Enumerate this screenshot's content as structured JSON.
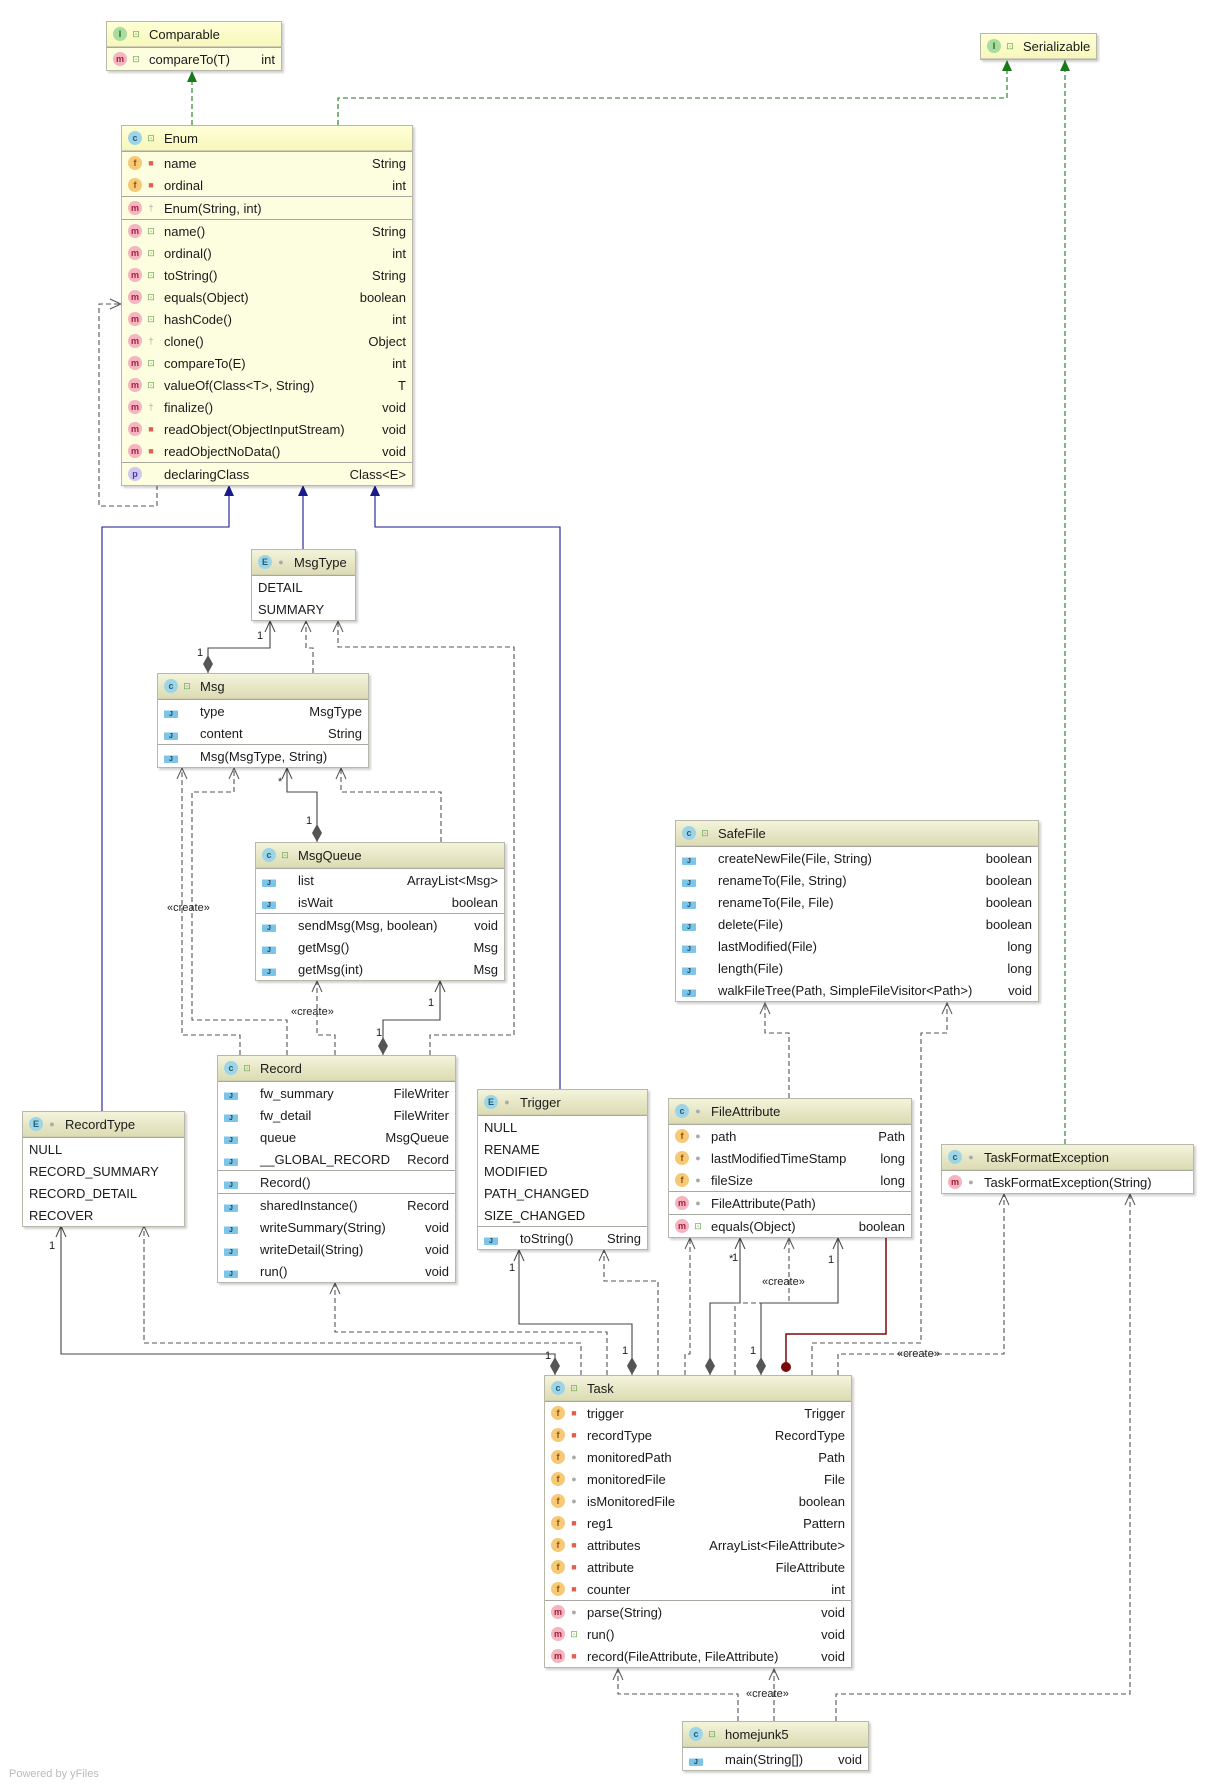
{
  "colors": {
    "realization": "#1a7a1a",
    "inheritance": "#1a1a8a",
    "dependency": "#555555",
    "composition": "#444444",
    "inner": "#7a0a0a"
  },
  "classes": [
    {
      "id": "comparable",
      "name": "Comparable",
      "kind": "i",
      "vis": "pub",
      "lib": true,
      "sections": [
        [
          {
            "icon": "m",
            "vis": "pub",
            "label": "compareTo(T)",
            "type": "int"
          }
        ]
      ]
    },
    {
      "id": "serializable",
      "name": "Serializable",
      "kind": "i",
      "vis": "pub",
      "lib": true,
      "sections": []
    },
    {
      "id": "enum",
      "name": "Enum",
      "kind": "c",
      "vis": "pub",
      "lib": true,
      "sections": [
        [
          {
            "icon": "f",
            "vis": "priv",
            "label": "name",
            "type": "String"
          },
          {
            "icon": "f",
            "vis": "priv",
            "label": "ordinal",
            "type": "int"
          }
        ],
        [
          {
            "icon": "m",
            "vis": "prot",
            "label": "Enum(String, int)",
            "type": ""
          }
        ],
        [
          {
            "icon": "m",
            "vis": "pub",
            "label": "name()",
            "type": "String"
          },
          {
            "icon": "m",
            "vis": "pub",
            "label": "ordinal()",
            "type": "int"
          },
          {
            "icon": "m",
            "vis": "pub",
            "label": "toString()",
            "type": "String"
          },
          {
            "icon": "m",
            "vis": "pub",
            "label": "equals(Object)",
            "type": "boolean"
          },
          {
            "icon": "m",
            "vis": "pub",
            "label": "hashCode()",
            "type": "int"
          },
          {
            "icon": "m",
            "vis": "prot",
            "label": "clone()",
            "type": "Object"
          },
          {
            "icon": "m",
            "vis": "pub",
            "label": "compareTo(E)",
            "type": "int"
          },
          {
            "icon": "m",
            "vis": "pub",
            "label": "valueOf(Class<T>, String)",
            "type": "T"
          },
          {
            "icon": "m",
            "vis": "prot",
            "label": "finalize()",
            "type": "void"
          },
          {
            "icon": "m",
            "vis": "priv",
            "label": "readObject(ObjectInputStream)",
            "type": "void"
          },
          {
            "icon": "m",
            "vis": "priv",
            "label": "readObjectNoData()",
            "type": "void"
          }
        ],
        [
          {
            "icon": "p",
            "vis": "none",
            "label": "declaringClass",
            "type": "Class<E>"
          }
        ]
      ]
    },
    {
      "id": "msgtype",
      "name": "MsgType",
      "kind": "e",
      "vis": "pkg",
      "lib": false,
      "sections": [
        [
          {
            "icon": "",
            "vis": "",
            "label": "DETAIL",
            "type": ""
          },
          {
            "icon": "",
            "vis": "",
            "label": "SUMMARY",
            "type": ""
          }
        ]
      ]
    },
    {
      "id": "msg",
      "name": "Msg",
      "kind": "c",
      "vis": "pub",
      "lib": false,
      "sections": [
        [
          {
            "icon": "s",
            "vis": "none",
            "label": "type",
            "type": "MsgType"
          },
          {
            "icon": "s",
            "vis": "none",
            "label": "content",
            "type": "String"
          }
        ],
        [
          {
            "icon": "s",
            "vis": "none",
            "label": "Msg(MsgType, String)",
            "type": ""
          }
        ]
      ]
    },
    {
      "id": "msgqueue",
      "name": "MsgQueue",
      "kind": "c",
      "vis": "pub",
      "lib": false,
      "sections": [
        [
          {
            "icon": "s",
            "vis": "none",
            "label": "list",
            "type": "ArrayList<Msg>"
          },
          {
            "icon": "s",
            "vis": "none",
            "label": "isWait",
            "type": "boolean"
          }
        ],
        [
          {
            "icon": "s",
            "vis": "none",
            "label": "sendMsg(Msg, boolean)",
            "type": "void"
          },
          {
            "icon": "s",
            "vis": "none",
            "label": "getMsg()",
            "type": "Msg"
          },
          {
            "icon": "s",
            "vis": "none",
            "label": "getMsg(int)",
            "type": "Msg"
          }
        ]
      ]
    },
    {
      "id": "record",
      "name": "Record",
      "kind": "c",
      "vis": "pub",
      "lib": false,
      "sections": [
        [
          {
            "icon": "s",
            "vis": "none",
            "label": "fw_summary",
            "type": "FileWriter"
          },
          {
            "icon": "s",
            "vis": "none",
            "label": "fw_detail",
            "type": "FileWriter"
          },
          {
            "icon": "s",
            "vis": "none",
            "label": "queue",
            "type": "MsgQueue"
          },
          {
            "icon": "s",
            "vis": "none",
            "label": "__GLOBAL_RECORD",
            "type": "Record"
          }
        ],
        [
          {
            "icon": "s",
            "vis": "none",
            "label": "Record()",
            "type": ""
          }
        ],
        [
          {
            "icon": "s",
            "vis": "none",
            "label": "sharedInstance()",
            "type": "Record"
          },
          {
            "icon": "s",
            "vis": "none",
            "label": "writeSummary(String)",
            "type": "void"
          },
          {
            "icon": "s",
            "vis": "none",
            "label": "writeDetail(String)",
            "type": "void"
          },
          {
            "icon": "s",
            "vis": "none",
            "label": "run()",
            "type": "void"
          }
        ]
      ]
    },
    {
      "id": "recordtype",
      "name": "RecordType",
      "kind": "e",
      "vis": "pkg",
      "lib": false,
      "sections": [
        [
          {
            "icon": "",
            "vis": "",
            "label": "NULL",
            "type": ""
          },
          {
            "icon": "",
            "vis": "",
            "label": "RECORD_SUMMARY",
            "type": ""
          },
          {
            "icon": "",
            "vis": "",
            "label": "RECORD_DETAIL",
            "type": ""
          },
          {
            "icon": "",
            "vis": "",
            "label": "RECOVER",
            "type": ""
          }
        ]
      ]
    },
    {
      "id": "trigger",
      "name": "Trigger",
      "kind": "e",
      "vis": "pkg",
      "lib": false,
      "sections": [
        [
          {
            "icon": "",
            "vis": "",
            "label": "NULL",
            "type": ""
          },
          {
            "icon": "",
            "vis": "",
            "label": "RENAME",
            "type": ""
          },
          {
            "icon": "",
            "vis": "",
            "label": "MODIFIED",
            "type": ""
          },
          {
            "icon": "",
            "vis": "",
            "label": "PATH_CHANGED",
            "type": ""
          },
          {
            "icon": "",
            "vis": "",
            "label": "SIZE_CHANGED",
            "type": ""
          }
        ],
        [
          {
            "icon": "s",
            "vis": "none",
            "label": "toString()",
            "type": "String"
          }
        ]
      ]
    },
    {
      "id": "safefile",
      "name": "SafeFile",
      "kind": "c",
      "vis": "pub",
      "lib": false,
      "sections": [
        [
          {
            "icon": "s",
            "vis": "none",
            "label": "createNewFile(File, String)",
            "type": "boolean"
          },
          {
            "icon": "s",
            "vis": "none",
            "label": "renameTo(File, String)",
            "type": "boolean"
          },
          {
            "icon": "s",
            "vis": "none",
            "label": "renameTo(File, File)",
            "type": "boolean"
          },
          {
            "icon": "s",
            "vis": "none",
            "label": "delete(File)",
            "type": "boolean"
          },
          {
            "icon": "s",
            "vis": "none",
            "label": "lastModified(File)",
            "type": "long"
          },
          {
            "icon": "s",
            "vis": "none",
            "label": "length(File)",
            "type": "long"
          },
          {
            "icon": "s",
            "vis": "none",
            "label": "walkFileTree(Path, SimpleFileVisitor<Path>)",
            "type": "void"
          }
        ]
      ]
    },
    {
      "id": "fileattribute",
      "name": "FileAttribute",
      "kind": "c",
      "vis": "pkg",
      "lib": false,
      "sections": [
        [
          {
            "icon": "f",
            "vis": "pkg",
            "label": "path",
            "type": "Path"
          },
          {
            "icon": "f",
            "vis": "pkg",
            "label": "lastModifiedTimeStamp",
            "type": "long"
          },
          {
            "icon": "f",
            "vis": "pkg",
            "label": "fileSize",
            "type": "long"
          }
        ],
        [
          {
            "icon": "m",
            "vis": "pkg",
            "label": "FileAttribute(Path)",
            "type": ""
          }
        ],
        [
          {
            "icon": "m",
            "vis": "pub",
            "label": "equals(Object)",
            "type": "boolean"
          }
        ]
      ]
    },
    {
      "id": "taskformatexception",
      "name": "TaskFormatException",
      "kind": "c",
      "vis": "pkg",
      "lib": false,
      "sections": [
        [
          {
            "icon": "m",
            "vis": "pkg",
            "label": "TaskFormatException(String)",
            "type": ""
          }
        ]
      ]
    },
    {
      "id": "task",
      "name": "Task",
      "kind": "c",
      "vis": "pub",
      "lib": false,
      "sections": [
        [
          {
            "icon": "f",
            "vis": "priv",
            "label": "trigger",
            "type": "Trigger"
          },
          {
            "icon": "f",
            "vis": "priv",
            "label": "recordType",
            "type": "RecordType"
          },
          {
            "icon": "f",
            "vis": "pkg",
            "label": "monitoredPath",
            "type": "Path"
          },
          {
            "icon": "f",
            "vis": "pkg",
            "label": "monitoredFile",
            "type": "File"
          },
          {
            "icon": "f",
            "vis": "pkg",
            "label": "isMonitoredFile",
            "type": "boolean"
          },
          {
            "icon": "f",
            "vis": "priv",
            "label": "reg1",
            "type": "Pattern"
          },
          {
            "icon": "f",
            "vis": "priv",
            "label": "attributes",
            "type": "ArrayList<FileAttribute>"
          },
          {
            "icon": "f",
            "vis": "priv",
            "label": "attribute",
            "type": "FileAttribute"
          },
          {
            "icon": "f",
            "vis": "priv",
            "label": "counter",
            "type": "int"
          }
        ],
        [
          {
            "icon": "m",
            "vis": "pkg",
            "label": "parse(String)",
            "type": "void"
          },
          {
            "icon": "m",
            "vis": "pub",
            "label": "run()",
            "type": "void"
          },
          {
            "icon": "m",
            "vis": "priv",
            "label": "record(FileAttribute, FileAttribute)",
            "type": "void"
          }
        ]
      ]
    },
    {
      "id": "homejunk5",
      "name": "homejunk5",
      "kind": "c",
      "vis": "pub",
      "lib": false,
      "sections": [
        [
          {
            "icon": "s",
            "vis": "none",
            "label": "main(String[])",
            "type": "void"
          }
        ]
      ]
    }
  ],
  "edge_labels": [
    "1",
    "1",
    "*",
    "1",
    "«create»",
    "«create»",
    "1",
    "1",
    "1",
    "1",
    "1",
    "1",
    "1",
    "*",
    "«create»",
    "1",
    "1",
    "«create»",
    "«create»"
  ],
  "footer": "Powered by yFiles"
}
